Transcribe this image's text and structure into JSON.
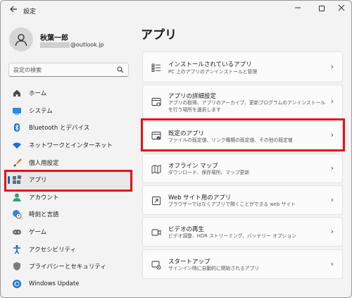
{
  "window": {
    "title": "設定"
  },
  "user": {
    "name": "秋葉一郎",
    "email_suffix": "@outlook.jp"
  },
  "search": {
    "placeholder": "設定の検索"
  },
  "nav": {
    "items": [
      {
        "label": "ホーム",
        "icon": "home-icon"
      },
      {
        "label": "システム",
        "icon": "system-icon"
      },
      {
        "label": "Bluetooth とデバイス",
        "icon": "bluetooth-icon"
      },
      {
        "label": "ネットワークとインターネット",
        "icon": "wifi-icon"
      },
      {
        "label": "個人用設定",
        "icon": "brush-icon"
      },
      {
        "label": "アプリ",
        "icon": "apps-icon",
        "active": true
      },
      {
        "label": "アカウント",
        "icon": "account-icon"
      },
      {
        "label": "時刻と言語",
        "icon": "clock-globe-icon"
      },
      {
        "label": "ゲーム",
        "icon": "gamepad-icon"
      },
      {
        "label": "アクセシビリティ",
        "icon": "accessibility-icon"
      },
      {
        "label": "プライバシーとセキュリティ",
        "icon": "shield-icon"
      },
      {
        "label": "Windows Update",
        "icon": "update-icon"
      }
    ]
  },
  "main": {
    "title": "アプリ",
    "cards": [
      {
        "title": "インストールされているアプリ",
        "desc": "PC 上のアプリのアンインストールと管理",
        "icon": "installed-apps-icon"
      },
      {
        "title": "アプリの詳細設定",
        "desc": "アプリの取得、アプリのアーカイブ、更新プログラムのアンインストールを行う場所を選択します",
        "icon": "advanced-apps-icon"
      },
      {
        "title": "既定のアプリ",
        "desc": "ファイルの既定値、リンク種類の既定値、その他の既定値",
        "icon": "default-apps-icon"
      },
      {
        "title": "オフライン マップ",
        "desc": "ダウンロード、保存場所、マップ更新",
        "icon": "offline-map-icon"
      },
      {
        "title": "Web サイト用のアプリ",
        "desc": "ブラウザーではなくアプリで開くことができる web サイト",
        "icon": "web-apps-icon"
      },
      {
        "title": "ビデオの再生",
        "desc": "ビデオ調整、HDR ストリーミング、バッテリー オプション",
        "icon": "video-icon"
      },
      {
        "title": "スタートアップ",
        "desc": "サインイン時に自動的に開始されるアプリ",
        "icon": "startup-icon"
      }
    ]
  },
  "colors": {
    "accent": "#0067c0",
    "highlight": "#e5101a"
  }
}
